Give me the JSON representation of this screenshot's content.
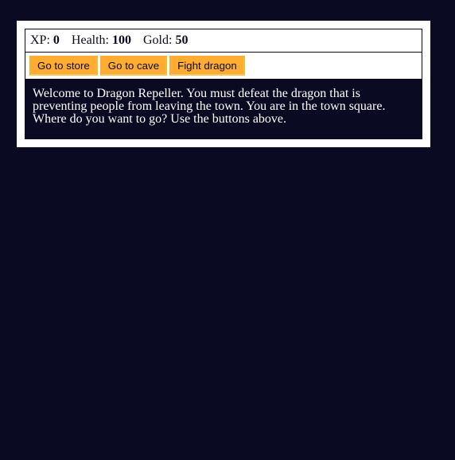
{
  "stats": {
    "xp_label": "XP:",
    "xp_value": "0",
    "health_label": "Health:",
    "health_value": "100",
    "gold_label": "Gold:",
    "gold_value": "50"
  },
  "controls": {
    "button1": "Go to store",
    "button2": "Go to cave",
    "button3": "Fight dragon"
  },
  "text": "Welcome to Dragon Repeller. You must defeat the dragon that is preventing people from leaving the town. You are in the town square. Where do you want to go? Use the buttons above.",
  "colors": {
    "background": "#0a0a23",
    "panel": "#ffffff",
    "button": "#feac32",
    "text_light": "#ffffff",
    "text_dark": "#0a0a23"
  }
}
